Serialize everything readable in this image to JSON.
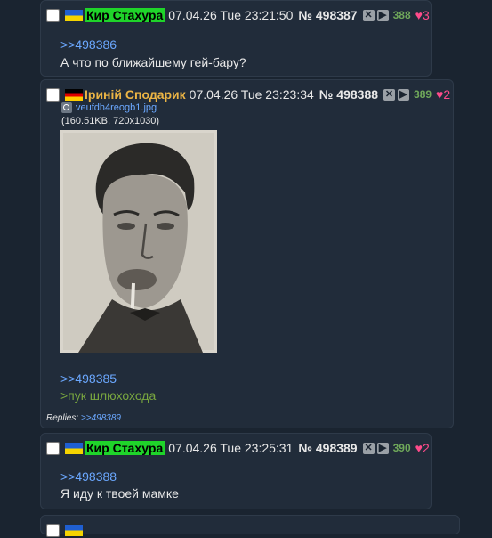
{
  "posts": [
    {
      "name": "Кир Стахура",
      "date": "07.04.26 Tue 23:21:50",
      "number": "№ 498387",
      "counter": "388",
      "likes": "3",
      "reply_link": ">>498386",
      "text": "А что по ближайшему гей-бару?"
    },
    {
      "name": "Іриній Сподарик",
      "date": "07.04.26 Tue 23:23:34",
      "number": "№ 498388",
      "counter": "389",
      "likes": "2",
      "file_name": "veufdh4reogb1.jpg",
      "file_info": "(160.51KB, 720x1030)",
      "reply_link": ">>498385",
      "greentext": ">пук шлюхохода",
      "replies_label": "Replies:",
      "replies_link": ">>498389"
    },
    {
      "name": "Кир Стахура",
      "date": "07.04.26 Tue 23:25:31",
      "number": "№ 498389",
      "counter": "390",
      "likes": "2",
      "reply_link": ">>498388",
      "text": "Я иду к твоей мамке"
    }
  ],
  "icons": {
    "hide": "close-icon",
    "play": "play-icon",
    "like": "heart-icon",
    "search": "magnifier-icon"
  },
  "colors": {
    "background": "#1a2430",
    "post": "#212c3a",
    "link": "#6ba8ff",
    "greentext": "#79a73f",
    "heart": "#ff4b8b"
  }
}
